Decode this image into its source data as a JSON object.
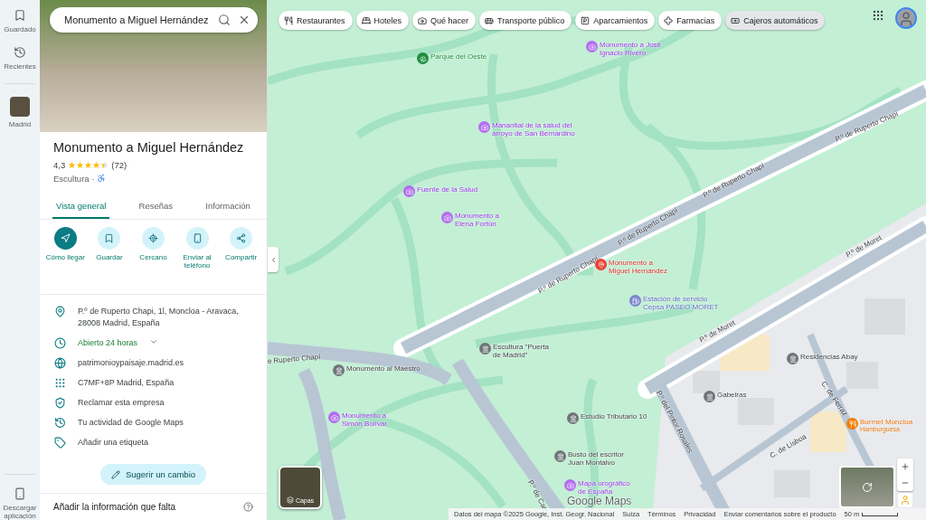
{
  "search": {
    "value": "Monumento a Miguel Hernández"
  },
  "rail": [
    {
      "kind": "saved",
      "label": "Guardado"
    },
    {
      "kind": "recent",
      "label": "Recientes"
    },
    {
      "kind": "place",
      "label": "Madrid"
    },
    {
      "kind": "app",
      "label": "Descargar aplicación"
    }
  ],
  "place": {
    "title": "Monumento a Miguel Hernández",
    "rating": "4,3",
    "stars": 4.5,
    "reviews": "(72)",
    "category": "Escultura ·",
    "wheelchair_accessible": true
  },
  "tabs": [
    {
      "label": "Vista general",
      "selected": true
    },
    {
      "label": "Reseñas",
      "selected": false
    },
    {
      "label": "Información",
      "selected": false
    }
  ],
  "actions": [
    {
      "kind": "directions",
      "label": "Cómo llegar",
      "primary": true
    },
    {
      "kind": "save",
      "label": "Guardar",
      "primary": false
    },
    {
      "kind": "nearby",
      "label": "Cercano",
      "primary": false
    },
    {
      "kind": "phone",
      "label": "Enviar al teléfono",
      "primary": false
    },
    {
      "kind": "share",
      "label": "Compartir",
      "primary": false
    }
  ],
  "info": [
    {
      "kind": "address",
      "text": "P.º de Ruperto Chapi, 1l, Moncloa - Aravaca, 28008 Madrid, España"
    },
    {
      "kind": "hours",
      "text": "Abierto 24 horas",
      "expandable": true
    },
    {
      "kind": "web",
      "text": "patrimonioypaisaje.madrid.es"
    },
    {
      "kind": "pluscode",
      "text": "C7MF+8P Madrid, España"
    },
    {
      "kind": "claim",
      "text": "Reclamar esta empresa"
    },
    {
      "kind": "activity",
      "text": "Tu actividad de Google Maps"
    },
    {
      "kind": "label",
      "text": "Añadir una etiqueta"
    }
  ],
  "suggest_button": "Sugerir un cambio",
  "missing_info": "Añadir la información que falta",
  "chips": [
    {
      "kind": "restaurants",
      "label": "Restaurantes",
      "selected": false
    },
    {
      "kind": "hotels",
      "label": "Hoteles",
      "selected": false
    },
    {
      "kind": "todo",
      "label": "Qué hacer",
      "selected": false
    },
    {
      "kind": "transit",
      "label": "Transporte público",
      "selected": false
    },
    {
      "kind": "parking",
      "label": "Aparcamientos",
      "selected": false
    },
    {
      "kind": "pharmacy",
      "label": "Farmacias",
      "selected": false
    },
    {
      "kind": "atm",
      "label": "Cajeros automáticos",
      "selected": true
    }
  ],
  "map_labels": [
    {
      "kind": "park",
      "text": "Parque del Oeste"
    },
    {
      "kind": "attraction",
      "text": "Monumento a José\nIgnacio Rivero"
    },
    {
      "kind": "attraction",
      "text": "Manantial de la salud del\narroyo de San Bernardino"
    },
    {
      "kind": "attraction",
      "text": "Fuente de la Salud"
    },
    {
      "kind": "attraction",
      "text": "Monumento a\nElena Fortún"
    },
    {
      "kind": "selected",
      "text": "Monumento a\nMiguel Hernández"
    },
    {
      "kind": "fuel",
      "text": "Estación de servicio\nCepsa PASEO MORET"
    },
    {
      "kind": "place",
      "text": "Escultura \"Puerta\nde Madrid\""
    },
    {
      "kind": "place",
      "text": "Monumento al Maestro"
    },
    {
      "kind": "attraction",
      "text": "Monumento a\nSimón Bolívar"
    },
    {
      "kind": "place",
      "text": "Residencias Abay"
    },
    {
      "kind": "place",
      "text": "Gabeiras"
    },
    {
      "kind": "place",
      "text": "Estudio Tributario 10"
    },
    {
      "kind": "food",
      "text": "Burmet Moncloa",
      "subtitle": "Hamburguesa"
    },
    {
      "kind": "place",
      "text": "Busto del escritor\nJuan Montalvo"
    },
    {
      "kind": "attraction",
      "text": "Mapa orográfico\nde España"
    }
  ],
  "road_labels": [
    "P.º de Ruperto Chapí",
    "P.º de Ruperto Chapí",
    "P.º de Ruperto Chapí",
    "P.º de Ruperto Chapí",
    "e Ruperto Chapí",
    "P.º de Moret",
    "P.º de Moret",
    "P.º del Pintor Rosales",
    "C. de Ferraz",
    "C. de Lisboa",
    "P.º de Cam"
  ],
  "layers_button": "Capas",
  "logo": "Google Maps",
  "footer": {
    "attribution": "Datos del mapa ©2025 Google, Inst. Geogr. Nacional",
    "links": [
      "Suiza",
      "Términos",
      "Privacidad",
      "Enviar comentarios sobre el producto"
    ],
    "scale": "50 m"
  }
}
